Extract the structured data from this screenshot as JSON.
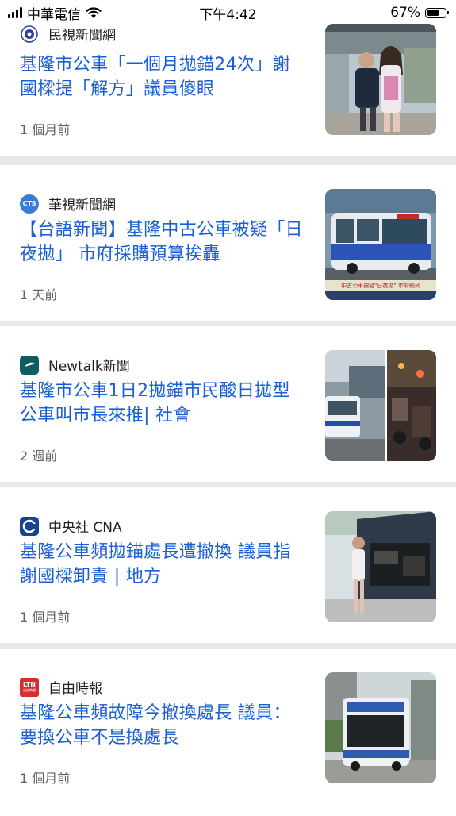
{
  "status_bar": {
    "carrier": "中華電信",
    "time": "下午4:42",
    "battery": "67%"
  },
  "articles": [
    {
      "source": "民視新聞網",
      "headline": "基隆市公車「一個月拋錨24次」謝國樑提「解方」議員傻眼",
      "time": "1 個月前",
      "logo_icon": "ftv-eye-logo",
      "thumb": "politician-and-candidate-at-bus-stop"
    },
    {
      "source": "華視新聞網",
      "headline": "【台語新聞】基隆中古公車被疑「日夜拋」 市府採購預算挨轟",
      "time": "1 天前",
      "logo_icon": "cts-logo",
      "logo_text": "CTS",
      "thumb": "blue-white-city-bus-news-frame",
      "thumb_caption": "中古公車被疑\"日夜拋\" 市府編列"
    },
    {
      "source": "Newtalk新聞",
      "headline": "基隆市公車1日2拋錨市民酸日拋型公車叫市長來推| 社會",
      "time": "2 週前",
      "logo_icon": "newtalk-logo",
      "thumb": "bus-split-photos-street-night"
    },
    {
      "source": "中央社 CNA",
      "headline": "基隆公車頻拋錨處長遭撤換 議員指謝國樑卸責 | 地方",
      "time": "1 個月前",
      "logo_icon": "cna-logo",
      "thumb": "open-bus-engine-bay-with-person"
    },
    {
      "source": "自由時報",
      "headline": "基隆公車頻故障今撤換處長 議員：要換公車不是換處長",
      "time": "1 個月前",
      "logo_icon": "ltn-logo",
      "logo_text": "LTN",
      "logo_subtext": "自由時報",
      "thumb": "bus-rear-among-buildings"
    }
  ],
  "colors": {
    "headline": "#1a5fd6",
    "background": "#e6e8eb",
    "card": "#ffffff",
    "meta": "#5f6368"
  }
}
